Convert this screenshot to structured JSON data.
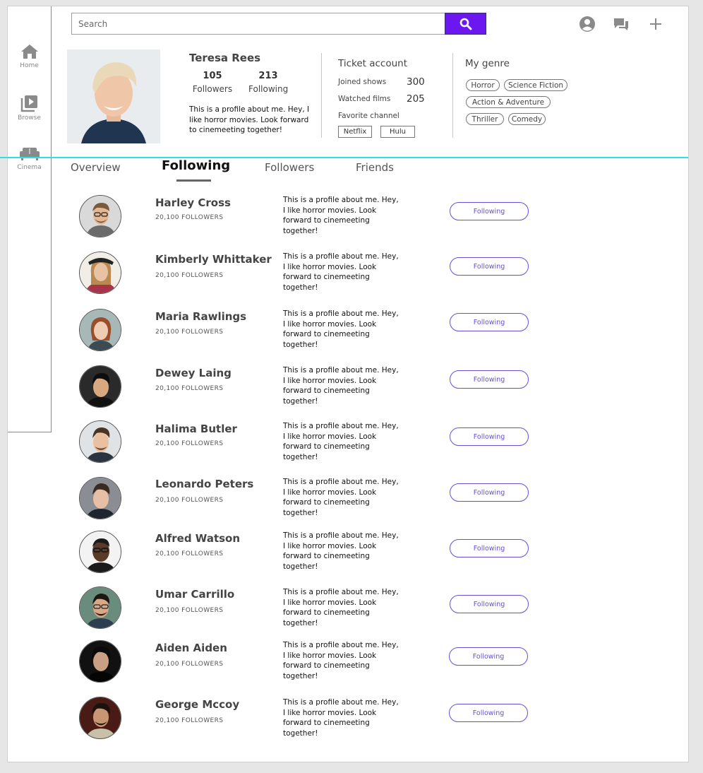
{
  "colors": {
    "accent": "#6c16f0",
    "divider": "#2fe0e0",
    "button_outline": "#6a4ed8"
  },
  "sidebar": {
    "items": [
      {
        "label": "Home",
        "icon": "home-icon"
      },
      {
        "label": "Browse",
        "icon": "play-library-icon"
      },
      {
        "label": "Cinema",
        "icon": "sofa-icon"
      }
    ]
  },
  "search": {
    "placeholder": "Search",
    "button_icon": "search-icon"
  },
  "header_icons": [
    "account-icon",
    "chat-icon",
    "plus-icon"
  ],
  "profile": {
    "name": "Teresa Rees",
    "followers_count": "105",
    "followers_label": "Followers",
    "following_count": "213",
    "following_label": "Following",
    "bio": "This is a profile about me. Hey, I like horror movies. Look forward to cinemeeting together!"
  },
  "ticket_account": {
    "title": "Ticket account",
    "joined_label": "Joined shows",
    "joined_value": "300",
    "watched_label": "Watched films",
    "watched_value": "205",
    "channel_label": "Favorite channel",
    "channels": [
      "Netflix",
      "Hulu"
    ]
  },
  "genres": {
    "title": "My genre",
    "items": [
      "Horror",
      "Science Fiction",
      "Action & Adventure",
      "Thriller",
      "Comedy"
    ]
  },
  "tabs": [
    {
      "label": "Overview",
      "active": false
    },
    {
      "label": "Following",
      "active": true
    },
    {
      "label": "Followers",
      "active": false
    },
    {
      "label": "Friends",
      "active": false
    }
  ],
  "following_list": [
    {
      "name": "Harley Cross",
      "followers": "20,100 FOLLOWERS",
      "bio": "This is a profile about me. Hey, I like horror movies. Look forward to cinemeeting together!",
      "button": "Following"
    },
    {
      "name": "Kimberly Whittaker",
      "followers": "20,100 FOLLOWERS",
      "bio": "This is a profile about me. Hey, I like horror movies. Look forward to cinemeeting together!",
      "button": "Following"
    },
    {
      "name": "Maria Rawlings",
      "followers": "20,100 FOLLOWERS",
      "bio": "This is a profile about me. Hey, I like horror movies. Look forward to cinemeeting together!",
      "button": "Following"
    },
    {
      "name": " Dewey Laing",
      "followers": "20,100 FOLLOWERS",
      "bio": "This is a profile about me. Hey, I like horror movies. Look forward to cinemeeting together!",
      "button": "Following"
    },
    {
      "name": "Halima Butler",
      "followers": "20,100 FOLLOWERS",
      "bio": "This is a profile about me. Hey, I like horror movies. Look forward to cinemeeting together!",
      "button": "Following"
    },
    {
      "name": "Leonardo Peters",
      "followers": "20,100 FOLLOWERS",
      "bio": "This is a profile about me. Hey, I like horror movies. Look forward to cinemeeting together!",
      "button": "Following"
    },
    {
      "name": "Alfred Watson",
      "followers": "20,100 FOLLOWERS",
      "bio": "This is a profile about me. Hey, I like horror movies. Look forward to cinemeeting together!",
      "button": "Following"
    },
    {
      "name": "Umar Carrillo",
      "followers": "20,100 FOLLOWERS",
      "bio": "This is a profile about me. Hey, I like horror movies. Look forward to cinemeeting together!",
      "button": "Following"
    },
    {
      "name": "Aiden Aiden",
      "followers": "20,100 FOLLOWERS",
      "bio": "This is a profile about me. Hey, I like horror movies. Look forward to cinemeeting together!",
      "button": "Following"
    },
    {
      "name": "George Mccoy",
      "followers": "20,100 FOLLOWERS",
      "bio": "This is a profile about me. Hey, I like horror movies. Look forward to cinemeeting together!",
      "button": "Following"
    }
  ]
}
